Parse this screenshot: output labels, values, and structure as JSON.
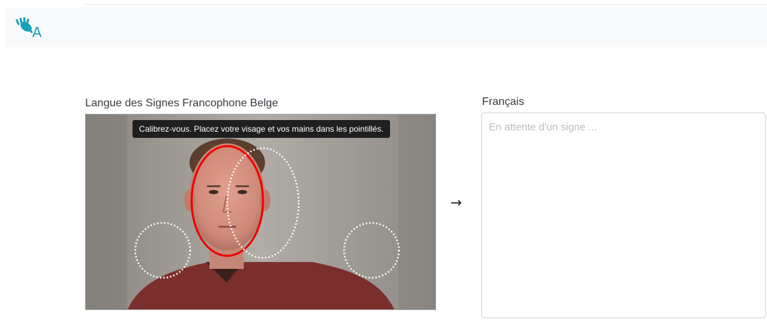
{
  "navbar": {
    "logo_icon": "sign-hand-icon",
    "logo_letter": "A",
    "brand_color": "#17a2b8"
  },
  "input_section": {
    "label": "Langue des Signes Francophone Belge",
    "video_caption": "Calibrez-vous. Placez votre visage et vos mains dans les pointillés.",
    "face_outline_color": "#ee0000"
  },
  "arrow_symbol": "→",
  "output_section": {
    "label": "Français",
    "placeholder": "En attente d'un signe ..."
  }
}
